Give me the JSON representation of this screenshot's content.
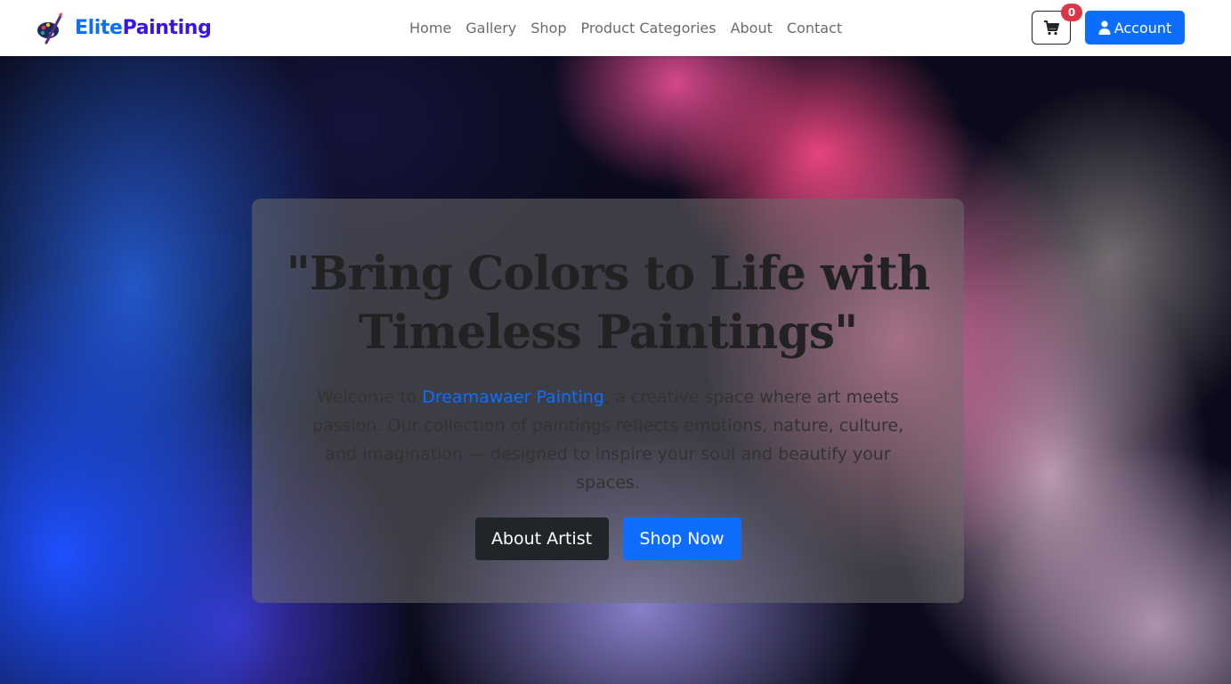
{
  "brand": {
    "name_part1": "Elite",
    "name_part2": "Painting",
    "logo_icon": "palette-brush-icon",
    "colors": {
      "elite": "#0d6efd",
      "painting": "#3b14e0"
    }
  },
  "nav": {
    "items": [
      {
        "label": "Home"
      },
      {
        "label": "Gallery"
      },
      {
        "label": "Shop"
      },
      {
        "label": "Product Categories"
      },
      {
        "label": "About"
      },
      {
        "label": "Contact"
      }
    ]
  },
  "cart": {
    "icon": "cart-icon",
    "count": "0",
    "badge_color": "#dc3545"
  },
  "account": {
    "label": "Account",
    "icon": "user-icon",
    "color": "#0d6efd"
  },
  "hero": {
    "title_line1": "\"Bring Colors to Life with",
    "title_line2": "Timeless Paintings\"",
    "text_before": "Welcome to ",
    "text_link": "Dreamawaer Painting",
    "text_after": ", a creative space where art meets passion. Our collection of paintings reflects emotions, nature, culture, and imagination — designed to inspire your soul and beautify your spaces.",
    "about_button": "About Artist",
    "shop_button": "Shop Now",
    "background": "colored smoke image"
  }
}
